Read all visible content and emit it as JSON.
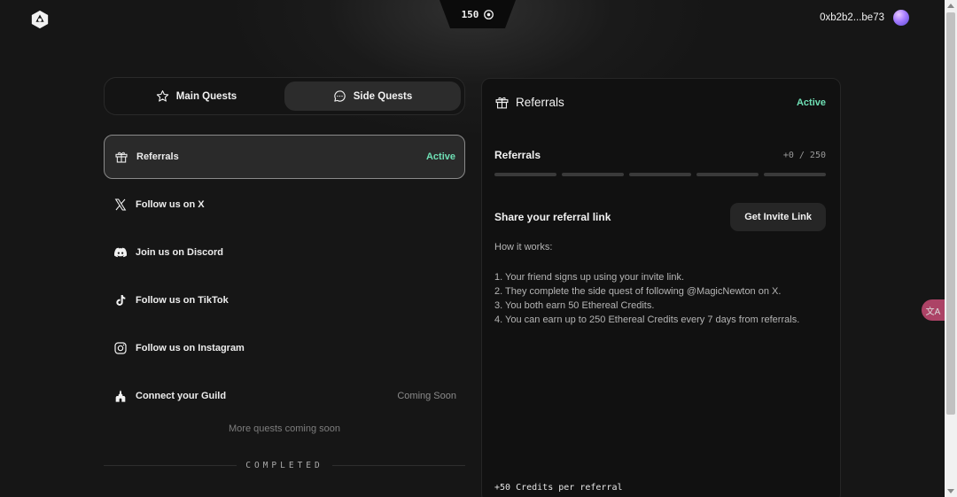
{
  "topbar": {
    "credits_value": "150",
    "wallet_address": "0xb2b2...be73"
  },
  "tabs": [
    {
      "label": "Main Quests",
      "icon": "star-icon",
      "active": false
    },
    {
      "label": "Side Quests",
      "icon": "chat-bubble-icon",
      "active": true
    }
  ],
  "quests": [
    {
      "label": "Referrals",
      "icon": "gift-icon",
      "status": "Active",
      "selected": true
    },
    {
      "label": "Follow us on X",
      "icon": "x-logo-icon",
      "status": "",
      "selected": false
    },
    {
      "label": "Join us on Discord",
      "icon": "discord-icon",
      "status": "",
      "selected": false
    },
    {
      "label": "Follow us on TikTok",
      "icon": "tiktok-icon",
      "status": "",
      "selected": false
    },
    {
      "label": "Follow us on Instagram",
      "icon": "instagram-icon",
      "status": "",
      "selected": false
    },
    {
      "label": "Connect your Guild",
      "icon": "castle-icon",
      "status": "Coming Soon",
      "selected": false
    }
  ],
  "more_quests_text": "More quests coming soon",
  "completed_label": "COMPLETED",
  "panel": {
    "title": "Referrals",
    "status": "Active",
    "progress_label": "Referrals",
    "progress_count": "+0 / 250",
    "progress_fraction": 0,
    "share_title": "Share your referral link",
    "invite_button": "Get Invite Link",
    "how_label": "How it works:",
    "steps": [
      "1. Your friend signs up using your invite link.",
      "2. They complete the side quest of following @MagicNewton on X.",
      "3. You both earn 50 Ethereal Credits.",
      "4. You can earn up to 250 Ethereal Credits every 7 days from referrals."
    ],
    "credits_note": "+50 Credits per referral"
  },
  "colors": {
    "background": "#161616",
    "accent_active": "#6fe0b5",
    "panel": "#111111"
  }
}
